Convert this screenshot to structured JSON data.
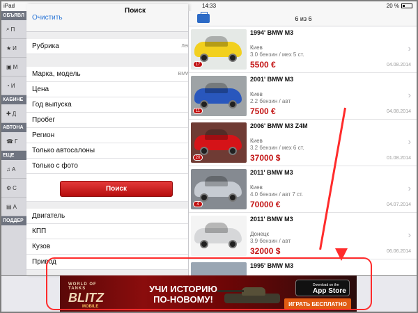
{
  "status": {
    "device": "iPad",
    "time": "14:33",
    "battery": "20 %"
  },
  "sidebar": {
    "sections": [
      "ОБЪЯВЛ",
      "КАБИНЕ",
      "АВТОНА",
      "ЕЩЕ",
      "ПОДДЕР"
    ],
    "items": [
      {
        "icon": "search-icon",
        "text": "П"
      },
      {
        "icon": "star-icon",
        "text": "И"
      },
      {
        "icon": "briefcase-icon",
        "text": "М"
      },
      {
        "icon": "clock-icon",
        "text": "И"
      },
      {
        "icon": "plus-icon",
        "text": "Д"
      },
      {
        "icon": "phone-icon",
        "text": "Г"
      },
      {
        "icon": "bell-icon",
        "text": "А"
      },
      {
        "icon": "gear-icon",
        "text": "С"
      },
      {
        "icon": "cart-icon",
        "text": "А"
      }
    ]
  },
  "filter": {
    "clear_label": "Очистить",
    "title": "Поиск",
    "rubric": {
      "label": "Рубрика",
      "value": "Легков"
    },
    "model": {
      "label": "Марка, модель",
      "value": "BMW, M"
    },
    "fields": [
      "Цена",
      "Год выпуска",
      "Пробег",
      "Регион",
      "Только автосалоны",
      "Только с фото"
    ],
    "search_label": "Поиск",
    "extra": [
      "Двигатель",
      "КПП",
      "Кузов",
      "Привод"
    ]
  },
  "list": {
    "count": "6 из 6",
    "items": [
      {
        "title": "1994' BMW M3",
        "city": "Киев",
        "spec": "3.0 бензин / мех 5 ст.",
        "price": "5500 €",
        "date": "04.08.2014",
        "badge": "17",
        "color": "#f3d317"
      },
      {
        "title": "2001' BMW M3",
        "city": "Киев",
        "spec": "2.2 бензин / авт",
        "price": "7500 €",
        "date": "04.08.2014",
        "badge": "11",
        "color": "#2a59be"
      },
      {
        "title": "2006' BMW M3 Z4M",
        "city": "Киев",
        "spec": "3.2 бензин / мех 6 ст.",
        "price": "37000 $",
        "date": "01.08.2014",
        "badge": "20",
        "color": "#d5131a"
      },
      {
        "title": "2011' BMW M3",
        "city": "Киев",
        "spec": "4.0 бензин / авт 7 ст.",
        "price": "70000 €",
        "date": "04.07.2014",
        "badge": "4",
        "color": "#c6cbd2"
      },
      {
        "title": "2011' BMW M3",
        "city": "Донецк",
        "spec": "3.9 бензин / авт",
        "price": "32000 $",
        "date": "06.06.2014",
        "badge": "",
        "color": "#d6d7d9"
      },
      {
        "title": "1995' BMW M3",
        "city": "",
        "spec": "",
        "price": "",
        "date": "",
        "badge": "",
        "color": "#9aa6b3"
      }
    ]
  },
  "banner": {
    "logo_top": "WORLD OF TANKS",
    "logo_main": "BLITZ",
    "logo_bottom": "MOBILE",
    "tagline": "УЧИ ИСТОРИЮ ПО-НОВОМУ!",
    "appstore_small": "Download on the",
    "appstore_big": "App Store",
    "cta": "ИГРАТЬ БЕСПЛАТНО"
  }
}
